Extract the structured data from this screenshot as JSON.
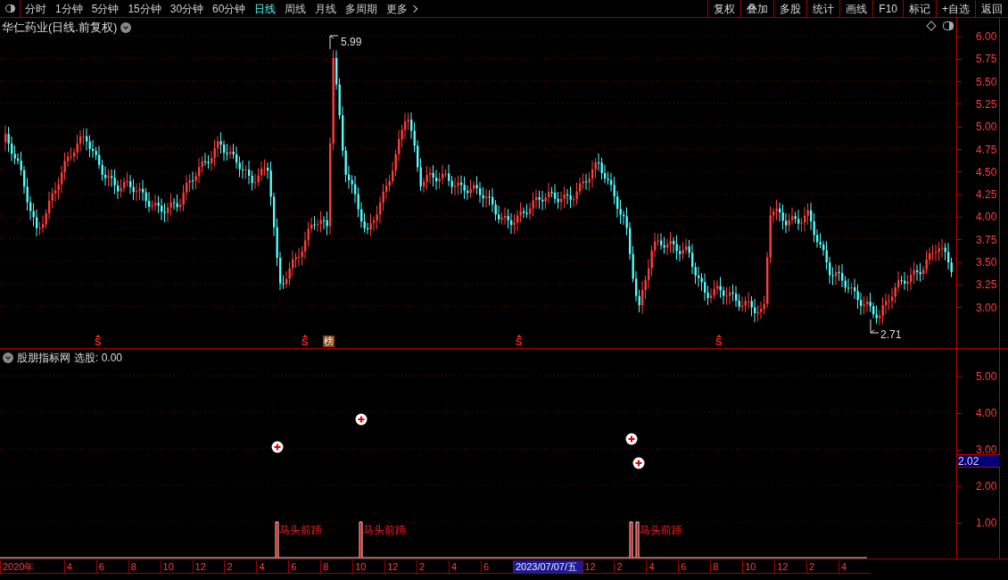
{
  "toolbar": {
    "periods": [
      {
        "label": "分时",
        "selected": false
      },
      {
        "label": "1分钟",
        "selected": false
      },
      {
        "label": "5分钟",
        "selected": false
      },
      {
        "label": "15分钟",
        "selected": false
      },
      {
        "label": "30分钟",
        "selected": false
      },
      {
        "label": "60分钟",
        "selected": false
      },
      {
        "label": "日线",
        "selected": true
      },
      {
        "label": "周线",
        "selected": false
      },
      {
        "label": "月线",
        "selected": false
      },
      {
        "label": "多周期",
        "selected": false
      },
      {
        "label": "更多",
        "selected": false
      }
    ],
    "buttons": [
      "复权",
      "叠加",
      "多股",
      "统计",
      "画线",
      "F10",
      "标记",
      "+自选",
      "返回"
    ]
  },
  "main_chart": {
    "title": "华仁药业(日线.前复权)",
    "high_label": "5.99",
    "low_label": "2.71",
    "price_ticks": [
      "6.00",
      "5.75",
      "5.50",
      "5.25",
      "5.00",
      "4.75",
      "4.50",
      "4.25",
      "4.00",
      "3.75",
      "3.50",
      "3.25",
      "3.00"
    ],
    "markers": [
      {
        "kind": "s",
        "text": "S"
      },
      {
        "kind": "s",
        "text": "S"
      },
      {
        "kind": "bang",
        "text": "榜"
      },
      {
        "kind": "s",
        "text": "S"
      },
      {
        "kind": "s",
        "text": "S"
      }
    ]
  },
  "indicator": {
    "name": "股朋指标网",
    "reading": "选股: 0.00",
    "ticks": [
      "5.00",
      "4.00",
      "3.00",
      "2.00",
      "1.00"
    ],
    "current_value": "2.02",
    "signals": [
      {
        "kind": "labeled",
        "label": "马头前蹄"
      },
      {
        "kind": "labeled",
        "label": "马头前蹄"
      },
      {
        "kind": "bare"
      },
      {
        "kind": "labeled",
        "label": "马头前蹄"
      }
    ]
  },
  "time_axis": [
    {
      "label": "2020年",
      "selected": false
    },
    {
      "label": "4",
      "selected": false
    },
    {
      "label": "6",
      "selected": false
    },
    {
      "label": "8",
      "selected": false
    },
    {
      "label": "10",
      "selected": false
    },
    {
      "label": "12",
      "selected": false
    },
    {
      "label": "2",
      "selected": false
    },
    {
      "label": "4",
      "selected": false
    },
    {
      "label": "6",
      "selected": false
    },
    {
      "label": "8",
      "selected": false
    },
    {
      "label": "10",
      "selected": false
    },
    {
      "label": "12",
      "selected": false
    },
    {
      "label": "2",
      "selected": false
    },
    {
      "label": "4",
      "selected": false
    },
    {
      "label": "6",
      "selected": false
    },
    {
      "label": "2023/07/07/五",
      "selected": true
    },
    {
      "label": "12",
      "selected": false
    },
    {
      "label": "2",
      "selected": false
    },
    {
      "label": "4",
      "selected": false
    },
    {
      "label": "6",
      "selected": false
    },
    {
      "label": "8",
      "selected": false
    },
    {
      "label": "10",
      "selected": false
    },
    {
      "label": "12",
      "selected": false
    },
    {
      "label": "2",
      "selected": false
    },
    {
      "label": "4",
      "selected": false
    }
  ]
}
